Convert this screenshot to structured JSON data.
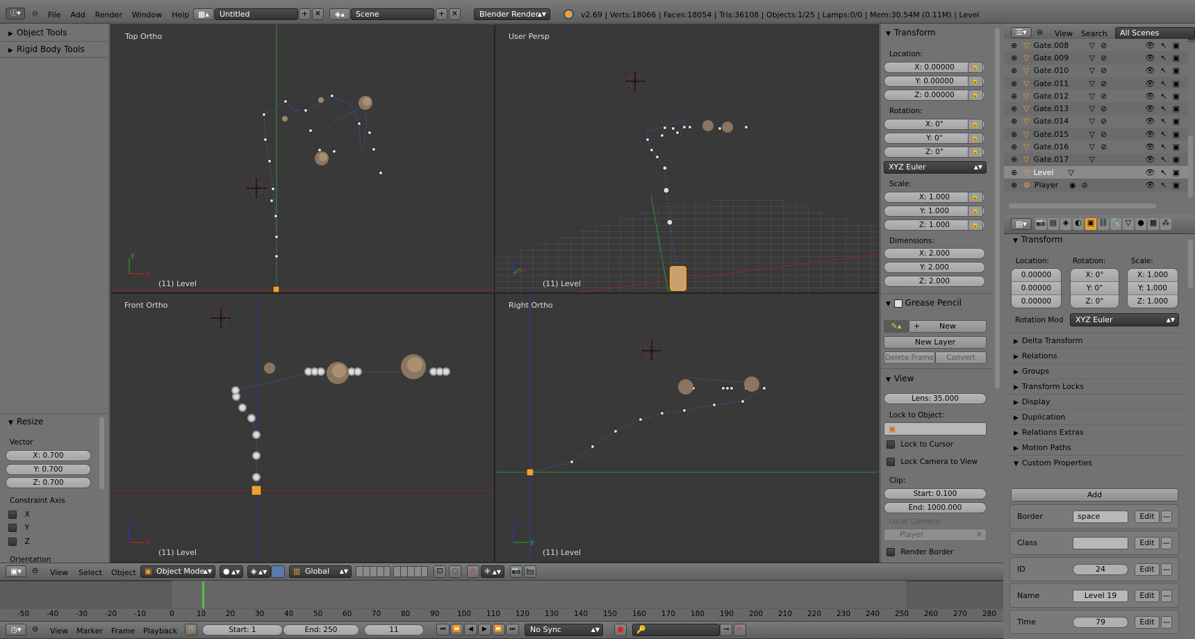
{
  "topbar": {
    "menu": [
      "File",
      "Add",
      "Render",
      "Window",
      "Help"
    ],
    "screen_name": "Untitled",
    "scene_name": "Scene",
    "render_engine": "Blender Render",
    "stats": "v2.69 | Verts:18066 | Faces:18054 | Tris:36108 | Objects:1/25 | Lamps:0/0 | Mem:30.54M (0.11M) | Level"
  },
  "toolshelf": {
    "tabs": [
      "Object Tools",
      "Rigid Body Tools"
    ],
    "operator": {
      "title": "Resize",
      "vector_label": "Vector",
      "vector": [
        "X: 0.700",
        "Y: 0.700",
        "Z: 0.700"
      ],
      "constraint_label": "Constraint Axis",
      "axes": [
        "X",
        "Y",
        "Z"
      ],
      "orientation_label": "Orientation"
    }
  },
  "viewports": [
    {
      "label": "Top Ortho",
      "status": "(11) Level"
    },
    {
      "label": "User Persp",
      "status": "(11) Level"
    },
    {
      "label": "Front Ortho",
      "status": "(11) Level"
    },
    {
      "label": "Right Ortho",
      "status": "(11) Level"
    }
  ],
  "npanel": {
    "transform_title": "Transform",
    "location_label": "Location:",
    "location": [
      "X: 0.00000",
      "Y: 0.00000",
      "Z: 0.00000"
    ],
    "rotation_label": "Rotation:",
    "rotation": [
      "X: 0°",
      "Y: 0°",
      "Z: 0°"
    ],
    "rotation_mode": "XYZ Euler",
    "scale_label": "Scale:",
    "scale": [
      "X: 1.000",
      "Y: 1.000",
      "Z: 1.000"
    ],
    "dimensions_label": "Dimensions:",
    "dimensions": [
      "X: 2.000",
      "Y: 2.000",
      "Z: 2.000"
    ],
    "grease_title": "Grease Pencil",
    "grease_new": "New",
    "grease_new_layer": "New Layer",
    "grease_delete_frame": "Delete Frame",
    "grease_convert": "Convert",
    "view_title": "View",
    "lens": "Lens: 35.000",
    "lock_object_label": "Lock to Object:",
    "lock_cursor": "Lock to Cursor",
    "lock_camera": "Lock Camera to View",
    "clip_label": "Clip:",
    "clip_start": "Start: 0.100",
    "clip_end": "End: 1000.000",
    "local_camera_label": "Local Camera:",
    "local_camera": "Player",
    "render_border": "Render Border"
  },
  "outliner": {
    "header": [
      "View",
      "Search"
    ],
    "scenes": "All Scenes",
    "rows": [
      "Gate.008",
      "Gate.009",
      "Gate.010",
      "Gate.011",
      "Gate.012",
      "Gate.013",
      "Gate.014",
      "Gate.015",
      "Gate.016",
      "Gate.017",
      "Level",
      "Player"
    ]
  },
  "properties": {
    "transform_title": "Transform",
    "location_label": "Location:",
    "rotation_label": "Rotation:",
    "scale_label": "Scale:",
    "location": [
      "0.00000",
      "0.00000",
      "0.00000"
    ],
    "rotation": [
      "X: 0°",
      "Y: 0°",
      "Z: 0°"
    ],
    "scale": [
      "X: 1.000",
      "Y: 1.000",
      "Z: 1.000"
    ],
    "rotation_mode_label": "Rotation Mod",
    "rotation_mode": "XYZ Euler",
    "subpanels": [
      "Delta Transform",
      "Relations",
      "Groups",
      "Transform Locks",
      "Display",
      "Duplication",
      "Relations Extras",
      "Motion Paths"
    ],
    "custom_title": "Custom Properties",
    "add_label": "Add",
    "edit_label": "Edit",
    "custom": [
      {
        "name": "Border",
        "value": "space"
      },
      {
        "name": "Class",
        "value": ""
      },
      {
        "name": "ID",
        "value": "24"
      },
      {
        "name": "Name",
        "value": "Level 19"
      },
      {
        "name": "Time",
        "value": "79"
      }
    ]
  },
  "view3d_header": {
    "menu": [
      "View",
      "Select",
      "Object"
    ],
    "mode": "Object Mode",
    "orientation": "Global"
  },
  "timeline": {
    "ticks": [
      "-50",
      "-40",
      "-30",
      "-20",
      "-10",
      "0",
      "10",
      "20",
      "30",
      "40",
      "50",
      "60",
      "70",
      "80",
      "90",
      "100",
      "110",
      "120",
      "130",
      "140",
      "150",
      "160",
      "170",
      "180",
      "190",
      "200",
      "210",
      "220",
      "230",
      "240",
      "250",
      "260",
      "270",
      "280"
    ],
    "current_frame": 11,
    "menu": [
      "View",
      "Marker",
      "Frame",
      "Playback"
    ],
    "start": "Start: 1",
    "end": "End: 250",
    "frame": "11",
    "sync": "No Sync"
  },
  "colors": {
    "accent": "#f0a030",
    "viewport_bg": "#393939",
    "selected": "#f0a030",
    "playhead": "#50c040"
  }
}
